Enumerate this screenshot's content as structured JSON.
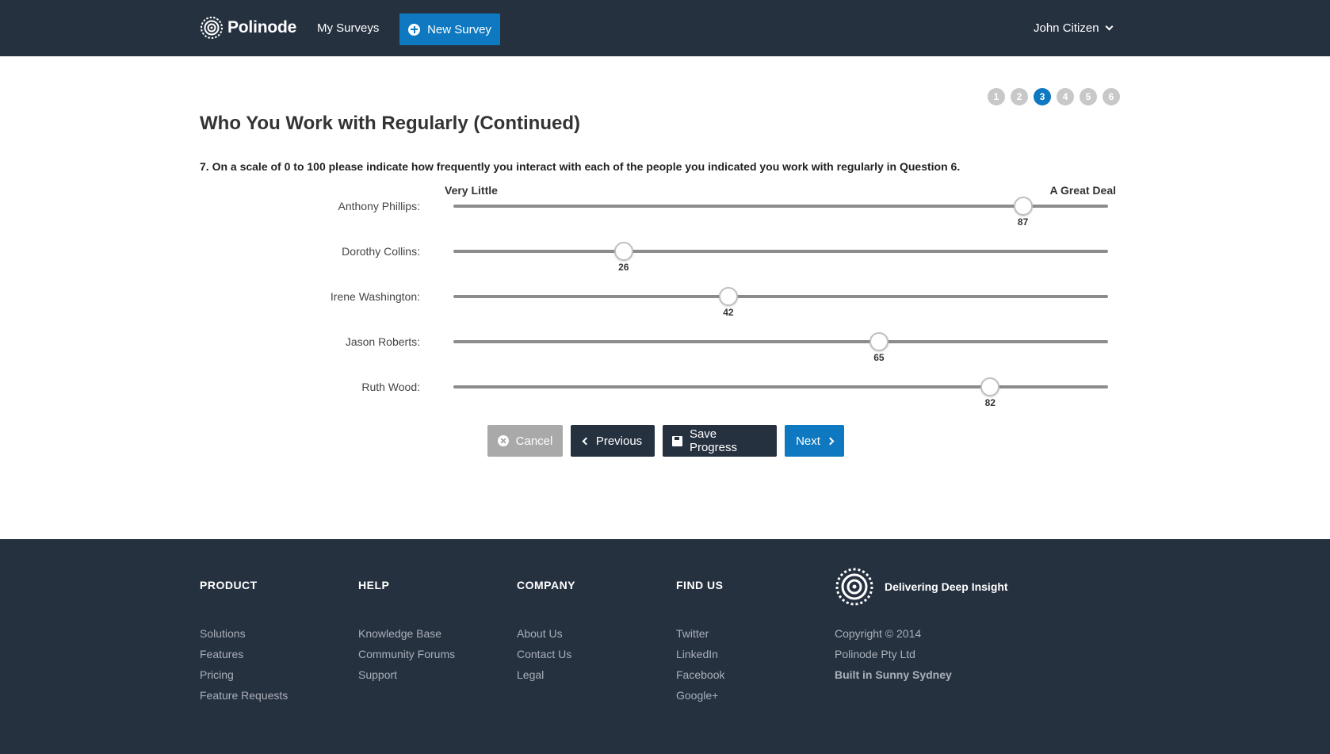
{
  "header": {
    "brand": "Polinode",
    "nav_my_surveys": "My Surveys",
    "new_survey_label": "New Survey",
    "user_name": "John Citizen"
  },
  "steps": {
    "items": [
      "1",
      "2",
      "3",
      "4",
      "5",
      "6"
    ],
    "active_index": 2
  },
  "page": {
    "title": "Who You Work with Regularly (Continued)",
    "question": "7. On a scale of 0 to 100 please indicate how frequently you interact with each of the people you indicated you work with regularly in Question 6.",
    "scale_low": "Very Little",
    "scale_high": "A Great Deal",
    "slider_min": 0,
    "slider_max": 100
  },
  "sliders": [
    {
      "label": "Anthony Phillips:",
      "value": "87"
    },
    {
      "label": "Dorothy Collins:",
      "value": "26"
    },
    {
      "label": "Irene Washington:",
      "value": "42"
    },
    {
      "label": "Jason Roberts:",
      "value": "65"
    },
    {
      "label": "Ruth Wood:",
      "value": "82"
    }
  ],
  "actions": {
    "cancel": "Cancel",
    "previous": "Previous",
    "save": "Save Progress",
    "next": "Next"
  },
  "footer": {
    "product": {
      "heading": "PRODUCT",
      "items": [
        "Solutions",
        "Features",
        "Pricing",
        "Feature Requests"
      ]
    },
    "help": {
      "heading": "HELP",
      "items": [
        "Knowledge Base",
        "Community Forums",
        "Support"
      ]
    },
    "company": {
      "heading": "COMPANY",
      "items": [
        "About Us",
        "Contact Us",
        "Legal"
      ]
    },
    "findus": {
      "heading": "FIND US",
      "items": [
        "Twitter",
        "LinkedIn",
        "Facebook",
        "Google+"
      ]
    },
    "tagline": "Delivering Deep Insight",
    "copyright": "Copyright © 2014",
    "company_name": "Polinode Pty Ltd",
    "built": "Built in Sunny Sydney"
  },
  "colors": {
    "header_bg": "#263140",
    "accent": "#0e79c0",
    "cancel_bg": "#a9a9a9"
  }
}
